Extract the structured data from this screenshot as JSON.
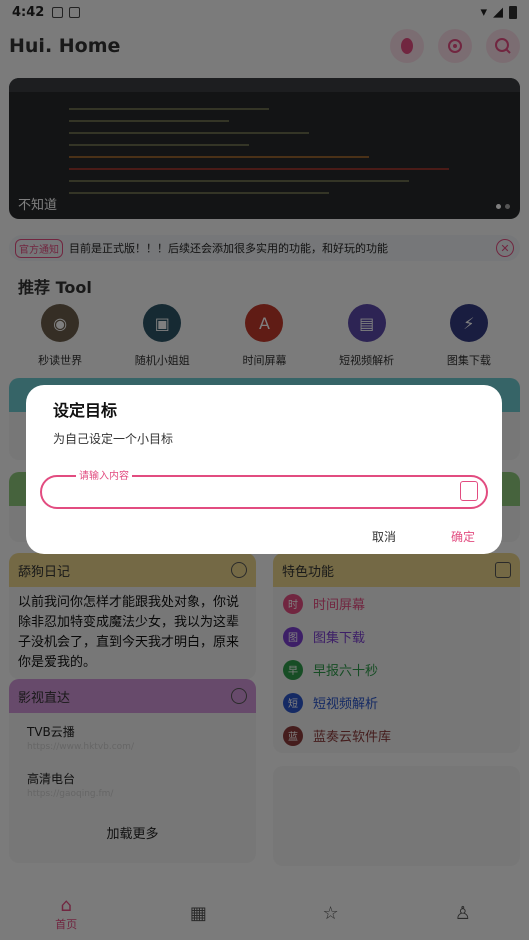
{
  "statusbar": {
    "time": "4:42"
  },
  "appbar": {
    "title": "Hui. Home"
  },
  "banner": {
    "caption": "不知道"
  },
  "notice": {
    "tag": "官方通知",
    "text": "目前是正式版！！！后续还会添加很多实用的功能，和好玩的功能",
    "close": "✕"
  },
  "tools_section": {
    "title": "推荐 Tool",
    "items": [
      {
        "label": "秒读世界",
        "color": "#6b5d4b",
        "glyph": "◉"
      },
      {
        "label": "随机小姐姐",
        "color": "#2c5466",
        "glyph": "▣"
      },
      {
        "label": "时间屏幕",
        "color": "#c0392b",
        "glyph": "A"
      },
      {
        "label": "短视频解析",
        "color": "#5b48a8",
        "glyph": "▤"
      },
      {
        "label": "图集下载",
        "color": "#333a80",
        "glyph": "⚡"
      }
    ]
  },
  "diary": {
    "title": "舔狗日记",
    "text": "以前我问你怎样才能跟我处对象，你说除非忍加特变成魔法少女，我以为这辈子没机会了，直到今天我才明白，原来你是爱我的。"
  },
  "features": {
    "title": "特色功能",
    "items": [
      {
        "badge": "时",
        "label": "时间屏幕",
        "color": "#e24c80"
      },
      {
        "badge": "图",
        "label": "图集下载",
        "color": "#7b3fcf"
      },
      {
        "badge": "早",
        "label": "早报六十秒",
        "color": "#2e9a4a"
      },
      {
        "badge": "短",
        "label": "短视频解析",
        "color": "#2a55c8"
      },
      {
        "badge": "蓝",
        "label": "蓝奏云软件库",
        "color": "#8a3a3a"
      }
    ]
  },
  "video": {
    "title": "影视直达",
    "entries": [
      {
        "name": "TVB云播",
        "url": "https://www.hktvb.com/"
      },
      {
        "name": "高清电台",
        "url": "https://gaoqing.fm/"
      }
    ],
    "more": "加载更多"
  },
  "bottom_nav": {
    "home": "首页"
  },
  "dialog": {
    "title": "设定目标",
    "message": "为自己设定一个小目标",
    "field_label": "请输入内容",
    "field_value": "",
    "cancel": "取消",
    "confirm": "确定"
  },
  "colors": {
    "accent": "#e24c80",
    "cyan": "#6cc8cf",
    "green": "#8cc77a",
    "yellow": "#e8d38a",
    "purple": "#cf94d7"
  }
}
